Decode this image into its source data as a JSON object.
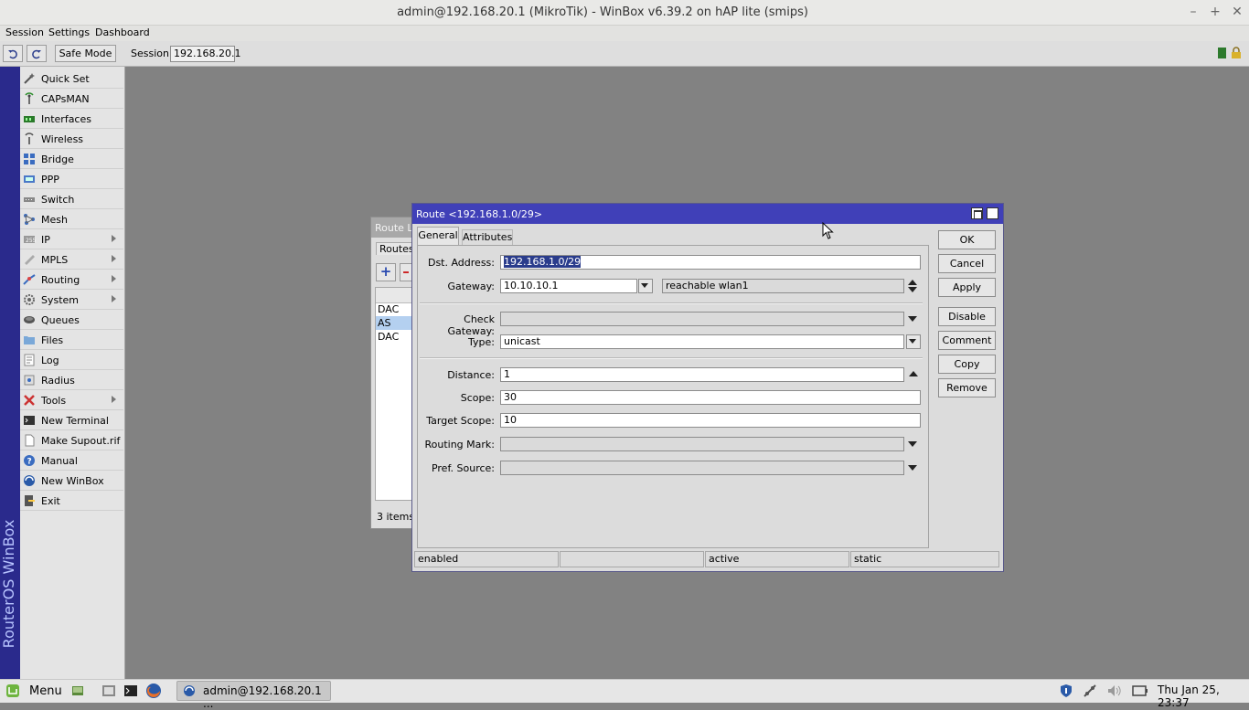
{
  "window": {
    "title": "admin@192.168.20.1 (MikroTik) - WinBox v6.39.2 on hAP lite (smips)"
  },
  "menubar": {
    "items": [
      "Session",
      "Settings",
      "Dashboard"
    ]
  },
  "toolbar": {
    "safe_mode": "Safe Mode",
    "session_label": "Session:",
    "session_value": "192.168.20.1"
  },
  "sidebar": {
    "brand": "RouterOS WinBox",
    "items": [
      {
        "label": "Quick Set",
        "icon": "wand-icon"
      },
      {
        "label": "CAPsMAN",
        "icon": "antenna-icon"
      },
      {
        "label": "Interfaces",
        "icon": "interfaces-icon"
      },
      {
        "label": "Wireless",
        "icon": "wireless-icon"
      },
      {
        "label": "Bridge",
        "icon": "bridge-icon"
      },
      {
        "label": "PPP",
        "icon": "ppp-icon"
      },
      {
        "label": "Switch",
        "icon": "switch-icon"
      },
      {
        "label": "Mesh",
        "icon": "mesh-icon"
      },
      {
        "label": "IP",
        "icon": "ip-icon"
      },
      {
        "label": "MPLS",
        "icon": "mpls-icon"
      },
      {
        "label": "Routing",
        "icon": "routing-icon"
      },
      {
        "label": "System",
        "icon": "gear-icon"
      },
      {
        "label": "Queues",
        "icon": "queues-icon"
      },
      {
        "label": "Files",
        "icon": "folder-icon"
      },
      {
        "label": "Log",
        "icon": "log-icon"
      },
      {
        "label": "Radius",
        "icon": "radius-icon"
      },
      {
        "label": "Tools",
        "icon": "tools-icon"
      },
      {
        "label": "New Terminal",
        "icon": "terminal-icon"
      },
      {
        "label": "Make Supout.rif",
        "icon": "document-icon"
      },
      {
        "label": "Manual",
        "icon": "help-icon"
      },
      {
        "label": "New WinBox",
        "icon": "winbox-icon"
      },
      {
        "label": "Exit",
        "icon": "exit-icon"
      }
    ]
  },
  "route_list": {
    "title": "Route Li",
    "tab": "Routes",
    "rows": [
      "DAC",
      "AS",
      "DAC"
    ],
    "footer": "3 items"
  },
  "dialog": {
    "title": "Route <192.168.1.0/29>",
    "tabs": [
      "General",
      "Attributes"
    ],
    "fields": {
      "dst_address": {
        "label": "Dst. Address:",
        "value": "192.168.1.0/29"
      },
      "gateway": {
        "label": "Gateway:",
        "value": "10.10.10.1",
        "state": "reachable wlan1"
      },
      "check_gateway": {
        "label": "Check Gateway:",
        "value": ""
      },
      "type": {
        "label": "Type:",
        "value": "unicast"
      },
      "distance": {
        "label": "Distance:",
        "value": "1"
      },
      "scope": {
        "label": "Scope:",
        "value": "30"
      },
      "target_scope": {
        "label": "Target Scope:",
        "value": "10"
      },
      "routing_mark": {
        "label": "Routing Mark:",
        "value": ""
      },
      "pref_source": {
        "label": "Pref. Source:",
        "value": ""
      }
    },
    "buttons": [
      "OK",
      "Cancel",
      "Apply",
      "Disable",
      "Comment",
      "Copy",
      "Remove"
    ],
    "status": [
      "enabled",
      "",
      "active",
      "static"
    ]
  },
  "taskbar": {
    "menu": "Menu",
    "task": "admin@192.168.20.1 ...",
    "clock": "Thu Jan 25, 23:37"
  },
  "colors": {
    "sidebar_brand_bg": "#2a2a8c",
    "dialog_title_bg": "#4040b8",
    "desktop_bg": "#828282"
  }
}
